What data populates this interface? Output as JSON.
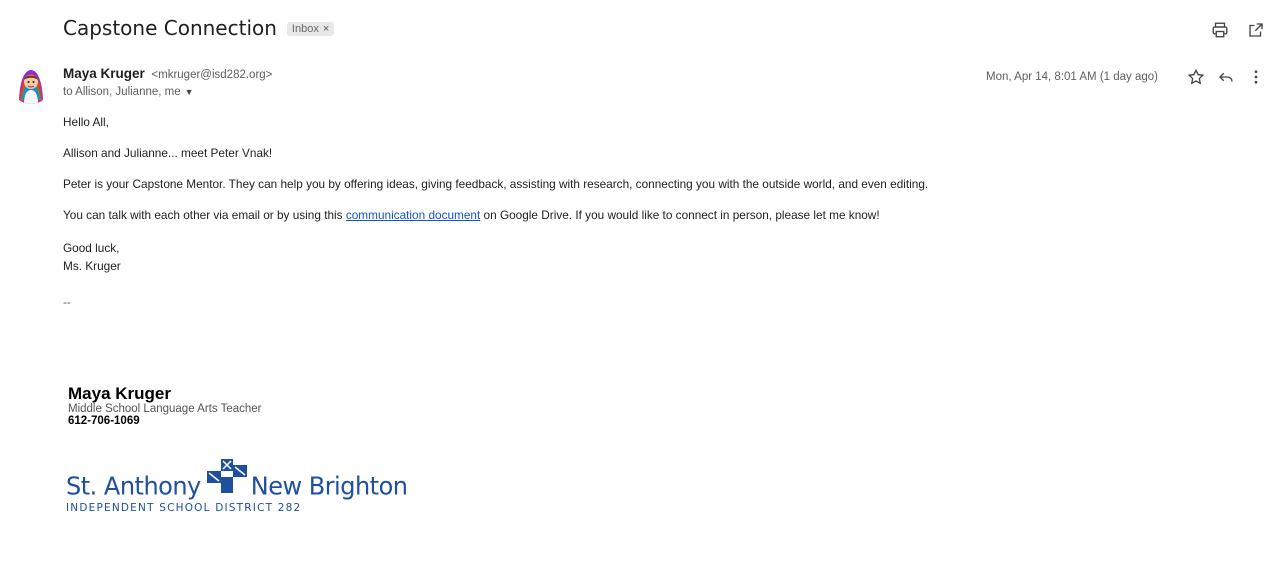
{
  "email": {
    "subject": "Capstone Connection",
    "label_chip": "Inbox",
    "label_chip_close": "×",
    "sender_name": "Maya Kruger",
    "sender_email": "<mkruger@isd282.org>",
    "recipients": "to Allison, Julianne, me",
    "date": "Mon, Apr 14, 8:01 AM (1 day ago)"
  },
  "body": {
    "greeting": "Hello All,",
    "line1": "Allison and Julianne... meet Peter Vnak!",
    "line2": "Peter is your Capstone Mentor. They can help you by offering ideas, giving feedback, assisting with research, connecting you with the outside world, and even editing.",
    "line3_before": "You can talk with each other via email or by using this ",
    "line3_link": "communication document",
    "line3_after": " on Google Drive. If you would like to connect in person, please let me know!",
    "closing": "Good luck,",
    "signoff": "Ms. Kruger",
    "separator": "--"
  },
  "signature": {
    "name": "Maya Kruger",
    "title": "Middle School Language Arts Teacher",
    "phone": "612-706-1069"
  },
  "logo": {
    "left_word": "St. Anthony",
    "right_word": "New Brighton",
    "subtitle": "INDEPENDENT SCHOOL DISTRICT 282",
    "color": "#1f4fa0"
  },
  "icons": {
    "print": "print-icon",
    "open_new_window": "open-in-new-window-icon",
    "star": "star-icon",
    "reply": "reply-icon",
    "more": "more-vert-icon",
    "caret": "caret-down-icon"
  },
  "colors": {
    "link": "#1155cc",
    "secondary_text": "#5e5e5e"
  }
}
